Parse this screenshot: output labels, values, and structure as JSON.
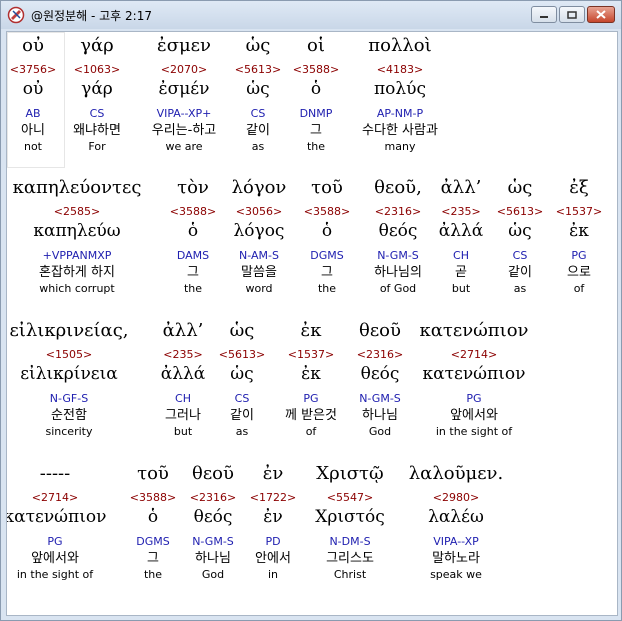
{
  "window": {
    "title": "@원정분해 - 고후 2:17"
  },
  "colors": {
    "strongs": "#8b0000",
    "morph": "#2020b0",
    "text": "#000000"
  },
  "icons": {
    "app": "bible-icon",
    "minimize": "minimize-icon",
    "maximize": "maximize-icon",
    "close": "close-icon"
  },
  "rows": [
    [
      {
        "greek": "οὐ",
        "strong": "<3756>",
        "lemma": "οὐ",
        "morph": "AB",
        "korean": "아니",
        "english": "not"
      },
      {
        "greek": "γάρ",
        "strong": "<1063>",
        "lemma": "γάρ",
        "morph": "CS",
        "korean": "왜냐하면",
        "english": "For"
      },
      {
        "greek": "ἐσμεν",
        "strong": "<2070>",
        "lemma": "ἐσμέν",
        "morph": "VIPA--XP+",
        "korean": "우리는-하고",
        "english": "we are"
      },
      {
        "greek": "ὡς",
        "strong": "<5613>",
        "lemma": "ὡς",
        "morph": "CS",
        "korean": "같이",
        "english": "as"
      },
      {
        "greek": "οἱ",
        "strong": "<3588>",
        "lemma": "ὁ",
        "morph": "DNMP",
        "korean": "그",
        "english": "the"
      },
      {
        "greek": "πολλοὶ",
        "strong": "<4183>",
        "lemma": "πολύς",
        "morph": "AP-NM-P",
        "korean": "수다한 사람과",
        "english": "many"
      }
    ],
    [
      {
        "greek": "καπηλεύοντες",
        "strong": "<2585>",
        "lemma": "καπηλεύω",
        "morph": "+VPPANMXP",
        "korean": "혼잡하게 하지",
        "english": "which corrupt"
      },
      {
        "greek": "τὸν",
        "strong": "<3588>",
        "lemma": "ὁ",
        "morph": "DAMS",
        "korean": "그",
        "english": "the"
      },
      {
        "greek": "λόγον",
        "strong": "<3056>",
        "lemma": "λόγος",
        "morph": "N-AM-S",
        "korean": "말씀을",
        "english": "word"
      },
      {
        "greek": "τοῦ",
        "strong": "<3588>",
        "lemma": "ὁ",
        "morph": "DGMS",
        "korean": "그",
        "english": "the"
      },
      {
        "greek": "θεοῦ,",
        "strong": "<2316>",
        "lemma": "θεός",
        "morph": "N-GM-S",
        "korean": "하나님의",
        "english": "of God"
      },
      {
        "greek": "ἀλλ’",
        "strong": "<235>",
        "lemma": "ἀλλά",
        "morph": "CH",
        "korean": "곧",
        "english": "but"
      },
      {
        "greek": "ὡς",
        "strong": "<5613>",
        "lemma": "ὡς",
        "morph": "CS",
        "korean": "같이",
        "english": "as"
      },
      {
        "greek": "ἐξ",
        "strong": "<1537>",
        "lemma": "ἐκ",
        "morph": "PG",
        "korean": "으로",
        "english": "of"
      }
    ],
    [
      {
        "greek": "εἰλικρινείας,",
        "strong": "<1505>",
        "lemma": "εἰλικρίνεια",
        "morph": "N-GF-S",
        "korean": "순전함",
        "english": "sincerity"
      },
      {
        "greek": "ἀλλ’",
        "strong": "<235>",
        "lemma": "ἀλλά",
        "morph": "CH",
        "korean": "그러나",
        "english": "but"
      },
      {
        "greek": "ὡς",
        "strong": "<5613>",
        "lemma": "ὡς",
        "morph": "CS",
        "korean": "같이",
        "english": "as"
      },
      {
        "greek": "ἐκ",
        "strong": "<1537>",
        "lemma": "ἐκ",
        "morph": "PG",
        "korean": "께 받은것",
        "english": "of"
      },
      {
        "greek": "θεοῦ",
        "strong": "<2316>",
        "lemma": "θεός",
        "morph": "N-GM-S",
        "korean": "하나님",
        "english": "God"
      },
      {
        "greek": "κατενώπιον",
        "strong": "<2714>",
        "lemma": "κατενώπιον",
        "morph": "PG",
        "korean": "앞에서와",
        "english": "in the sight of"
      }
    ],
    [
      {
        "greek": "-----",
        "strong": "<2714>",
        "lemma": "κατενώπιον",
        "morph": "PG",
        "korean": "앞에서와",
        "english": "in the sight of"
      },
      {
        "greek": "τοῦ",
        "strong": "<3588>",
        "lemma": "ὁ",
        "morph": "DGMS",
        "korean": "그",
        "english": "the"
      },
      {
        "greek": "θεοῦ",
        "strong": "<2316>",
        "lemma": "θεός",
        "morph": "N-GM-S",
        "korean": "하나님",
        "english": "God"
      },
      {
        "greek": "ἐν",
        "strong": "<1722>",
        "lemma": "ἐν",
        "morph": "PD",
        "korean": "안에서",
        "english": "in"
      },
      {
        "greek": "Χριστῷ",
        "strong": "<5547>",
        "lemma": "Χριστός",
        "morph": "N-DM-S",
        "korean": "그리스도",
        "english": "Christ"
      },
      {
        "greek": "λαλοῦμεν.",
        "strong": "<2980>",
        "lemma": "λαλέω",
        "morph": "VIPA--XP",
        "korean": "말하노라",
        "english": "speak we"
      }
    ]
  ]
}
